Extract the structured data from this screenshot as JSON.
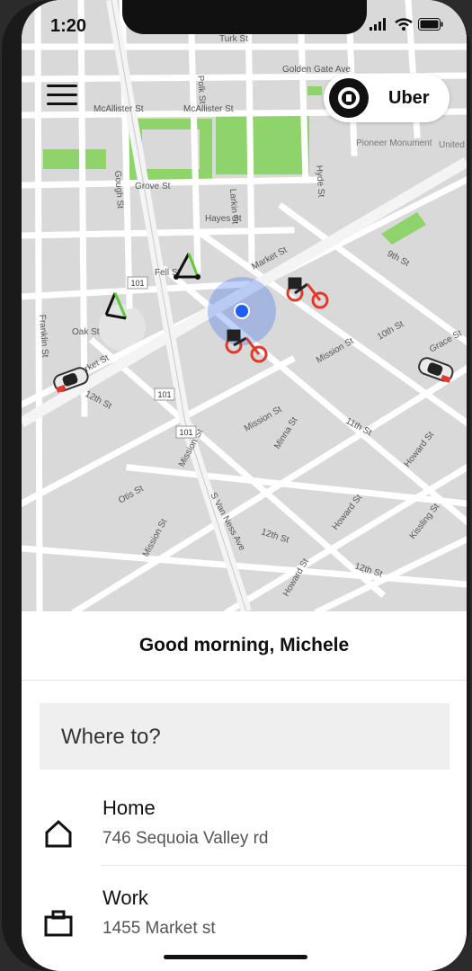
{
  "status_bar": {
    "time": "1:20",
    "route_badge": "101"
  },
  "header": {
    "brand_label": "Uber"
  },
  "map": {
    "street_labels": [
      "Turk St",
      "Golden Gate Ave",
      "McAllister St",
      "McAllister St",
      "Grove St",
      "Fell St",
      "Oak St",
      "Market St",
      "Hayes St",
      "Market St",
      "Mission St",
      "Mission St",
      "12th St",
      "Otis St",
      "Mission St",
      "S Van Ness Ave",
      "Mission St",
      "11th St",
      "10th St",
      "Minna St",
      "Howard St",
      "Howard St",
      "Kissling St",
      "12th St",
      "12th St",
      "9th St",
      "Howard St",
      "Polk St",
      "Franklin St",
      "Gough St",
      "Larkin St",
      "Hyde St",
      "Grace St"
    ],
    "highway_badges": [
      "101",
      "101",
      "101"
    ],
    "poi_labels": [
      "Pioneer Monument",
      "United Nations"
    ]
  },
  "sheet": {
    "greeting": "Good morning, Michele",
    "search_placeholder": "Where to?",
    "places": [
      {
        "title": "Home",
        "address": "746 Sequoia Valley rd",
        "icon": "home-icon"
      },
      {
        "title": "Work",
        "address": "1455 Market st",
        "icon": "briefcase-icon"
      }
    ]
  },
  "colors": {
    "accent_blue": "#1f5ef0",
    "bike_red": "#e23a2a",
    "park_green": "#8ed46a",
    "scooter_green": "#5ec93a"
  }
}
